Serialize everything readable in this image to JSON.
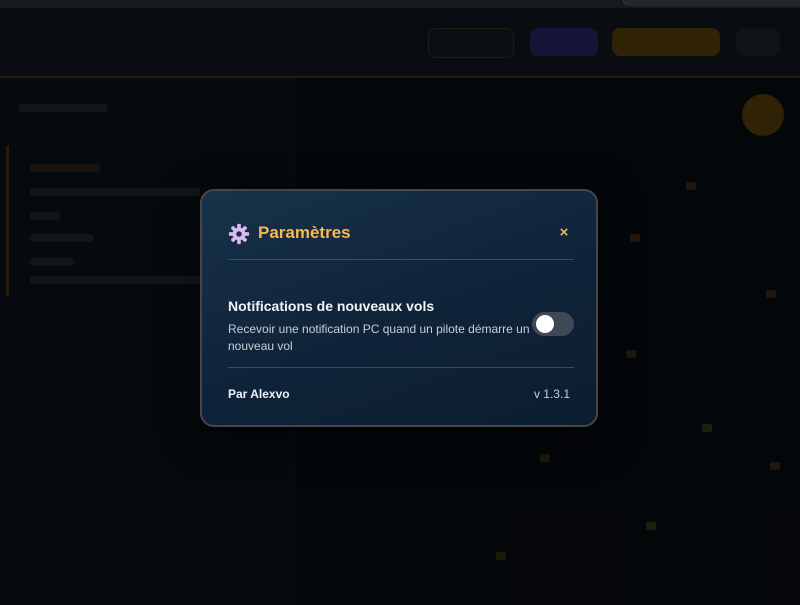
{
  "modal": {
    "title": "Paramètres",
    "close_label": "×",
    "icon": "gear-icon",
    "setting": {
      "label": "Notifications de nouveaux vols",
      "description": "Recevoir une notification PC quand un pilote démarre un nouveau vol",
      "enabled": false
    },
    "footer": {
      "author": "Par Alexvo",
      "version": "v 1.3.1"
    }
  },
  "colors": {
    "accent": "#f7b84b",
    "modal_bg": "#0f2338",
    "toggle_off": "#3d4854"
  }
}
